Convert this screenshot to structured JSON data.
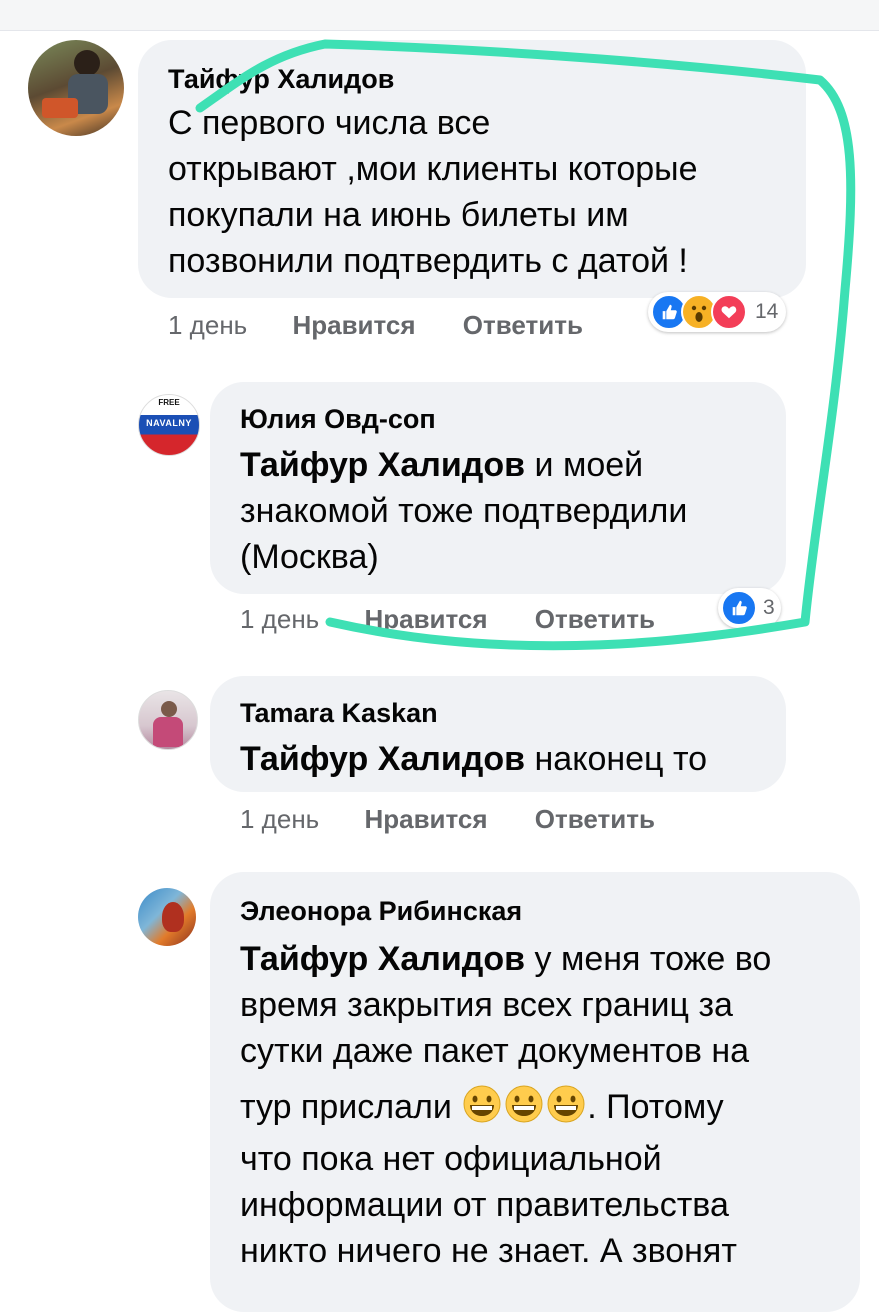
{
  "comments": [
    {
      "author": "Тайфур Халидов",
      "lines": [
        "С первого числа все",
        "открывают ,мои клиенты которые",
        "покупали на июнь билеты им",
        "позвонили подтвердить с датой !"
      ],
      "time": "1 день",
      "like_label": "Нравится",
      "reply_label": "Ответить",
      "reactions": [
        "like-icon",
        "wow-icon",
        "love-icon"
      ],
      "reaction_count": "14"
    },
    {
      "author": "Юлия Овд-соп",
      "mention": "Тайфур Халидов",
      "line1_rest": " и моей",
      "lines": [
        "знакомой тоже подтвердили",
        "(Москва)"
      ],
      "avatar_text": [
        "FREE",
        "NAVALNY"
      ],
      "time": "1 день",
      "like_label": "Нравится",
      "reply_label": "Ответить",
      "reactions": [
        "like-icon"
      ],
      "reaction_count": "3"
    },
    {
      "author": "Tamara Kaskan",
      "mention": "Тайфур Халидов",
      "line1_rest": " наконец то",
      "time": "1 день",
      "like_label": "Нравится",
      "reply_label": "Ответить"
    },
    {
      "author": "Элеонора Рибинская",
      "mention": "Тайфур Халидов",
      "line1_rest": " у меня тоже во",
      "lines": [
        "время закрытия всех границ за",
        "сутки даже пакет документов на"
      ],
      "line4_start": "тур прислали ",
      "line4_end": ". Потому",
      "lines_after": [
        "что пока нет официальной",
        "информации от правительства",
        "никто ничего не знает. А звонят"
      ],
      "emojis": [
        "grinning-face-icon",
        "grinning-face-icon",
        "grinning-face-icon"
      ]
    }
  ],
  "colors": {
    "bubble": "#f0f2f5",
    "meta_text": "#65676b",
    "like_blue": "#1877f2",
    "love_red": "#f33e58",
    "wow_yellow": "#f7b125",
    "annotation_stroke": "#3ee0b4"
  }
}
